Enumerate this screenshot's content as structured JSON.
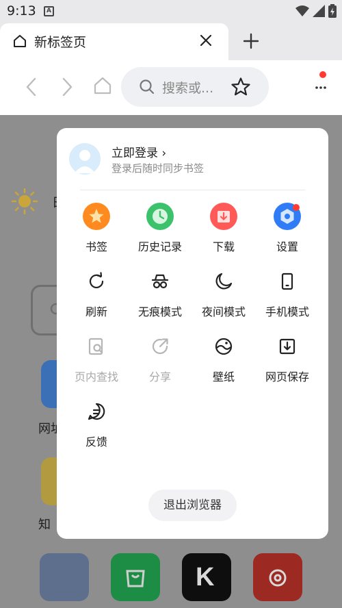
{
  "status_bar": {
    "time": "9:13"
  },
  "tab": {
    "title": "新标签页"
  },
  "toolbar": {
    "search_placeholder": "搜索或..."
  },
  "background": {
    "weather_partial": "日",
    "site_label_1": "网址",
    "site_label_2": "知",
    "bottom_apps": [
      "game-app",
      "shopping-app",
      "k-app",
      "music-app"
    ]
  },
  "menu": {
    "login_title": "立即登录 ›",
    "login_subtitle": "登录后随时同步书签",
    "items": [
      {
        "label": "书签",
        "icon": "bookmark-star-icon",
        "enabled": true
      },
      {
        "label": "历史记录",
        "icon": "history-clock-icon",
        "enabled": true
      },
      {
        "label": "下载",
        "icon": "download-icon",
        "enabled": true
      },
      {
        "label": "设置",
        "icon": "settings-icon",
        "enabled": true
      },
      {
        "label": "刷新",
        "icon": "refresh-icon",
        "enabled": true
      },
      {
        "label": "无痕模式",
        "icon": "incognito-icon",
        "enabled": true
      },
      {
        "label": "夜间模式",
        "icon": "moon-icon",
        "enabled": true
      },
      {
        "label": "手机模式",
        "icon": "phone-icon",
        "enabled": true
      },
      {
        "label": "页内查找",
        "icon": "find-in-page-icon",
        "enabled": false
      },
      {
        "label": "分享",
        "icon": "share-icon",
        "enabled": false
      },
      {
        "label": "壁纸",
        "icon": "wallpaper-icon",
        "enabled": true
      },
      {
        "label": "网页保存",
        "icon": "save-page-icon",
        "enabled": true
      },
      {
        "label": "反馈",
        "icon": "feedback-icon",
        "enabled": true
      }
    ],
    "exit_label": "退出浏览器"
  },
  "colors": {
    "bookmark": "#ff8a1f",
    "history": "#3cc26a",
    "download": "#ff5a57",
    "settings": "#2f7cf6",
    "badge": "#ff3b30",
    "dim_overlay": "#8e8e8e"
  }
}
